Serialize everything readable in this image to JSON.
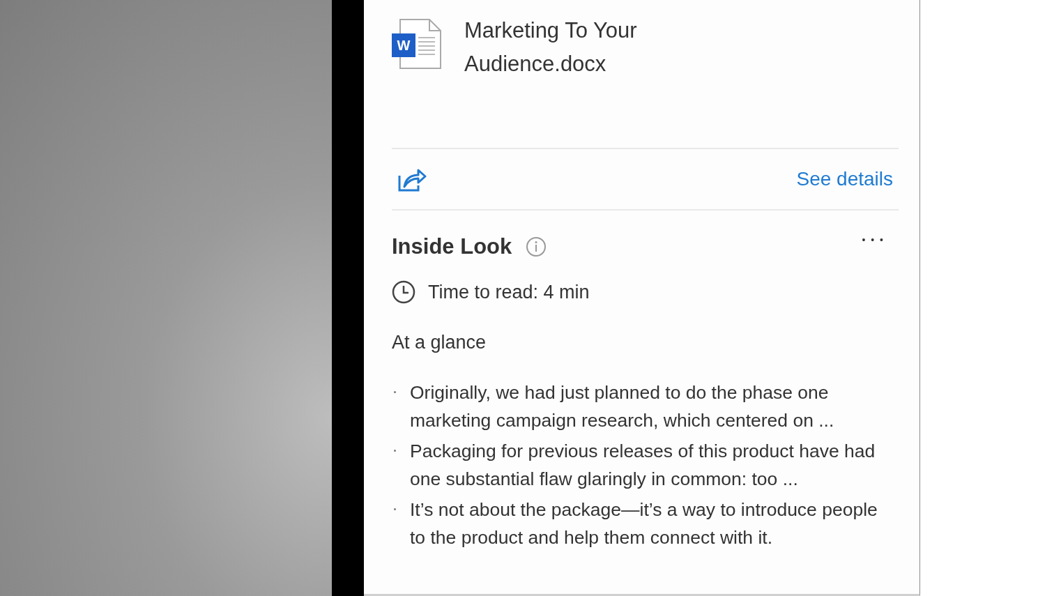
{
  "file": {
    "type_badge": "W",
    "name": "Marketing To Your Audience.docx"
  },
  "actions": {
    "details_link": "See details"
  },
  "inside_look": {
    "title": "Inside Look",
    "more": "• • •",
    "time_to_read": "Time to read: 4 min",
    "section_title": "At a glance",
    "bullets": [
      "Originally, we had just planned to do the phase one marketing campaign research, which centered on ...",
      "Packaging for previous releases of this product have had one substantial flaw glaringly in common: too ...",
      "It’s not about the package—it’s a way to introduce people to the product and help them connect with it."
    ]
  }
}
